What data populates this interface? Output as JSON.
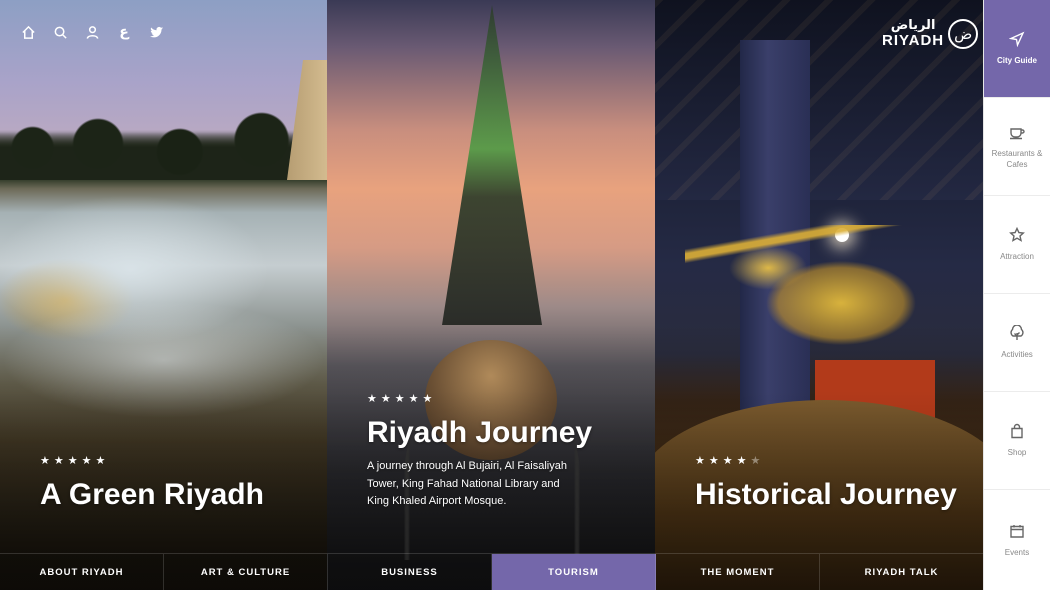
{
  "top_icons": {
    "arabic": "ع"
  },
  "logo": {
    "arabic": "الرياض",
    "english": "RIYADH",
    "mark": "ض"
  },
  "panels": [
    {
      "stars": [
        "★",
        "★",
        "★",
        "★",
        "★"
      ],
      "title": "A Green Riyadh"
    },
    {
      "stars": [
        "★",
        "★",
        "★",
        "★",
        "★"
      ],
      "title": "Riyadh Journey",
      "description": "A journey through Al Bujairi, Al Faisaliyah Tower, King Fahad National Library and King Khaled Airport Mosque."
    },
    {
      "stars": [
        "★",
        "★",
        "★",
        "★",
        "★"
      ],
      "rating": 4,
      "title": "Historical Journey"
    }
  ],
  "bottom_nav": [
    "ABOUT RIYADH",
    "ART & CULTURE",
    "BUSINESS",
    "TOURISM",
    "THE MOMENT",
    "RIYADH TALK"
  ],
  "bottom_nav_active": "TOURISM",
  "sidebar": [
    {
      "label": "City Guide",
      "icon": "navigation-arrow-icon"
    },
    {
      "label": "Restaurants & Cafes",
      "icon": "coffee-cup-icon"
    },
    {
      "label": "Attraction",
      "icon": "star-icon"
    },
    {
      "label": "Activities",
      "icon": "tree-icon"
    },
    {
      "label": "Shop",
      "icon": "shopping-bag-icon"
    },
    {
      "label": "Events",
      "icon": "calendar-icon"
    }
  ],
  "colors": {
    "accent": "#7467aa",
    "sidebar_bg": "#ffffff"
  }
}
